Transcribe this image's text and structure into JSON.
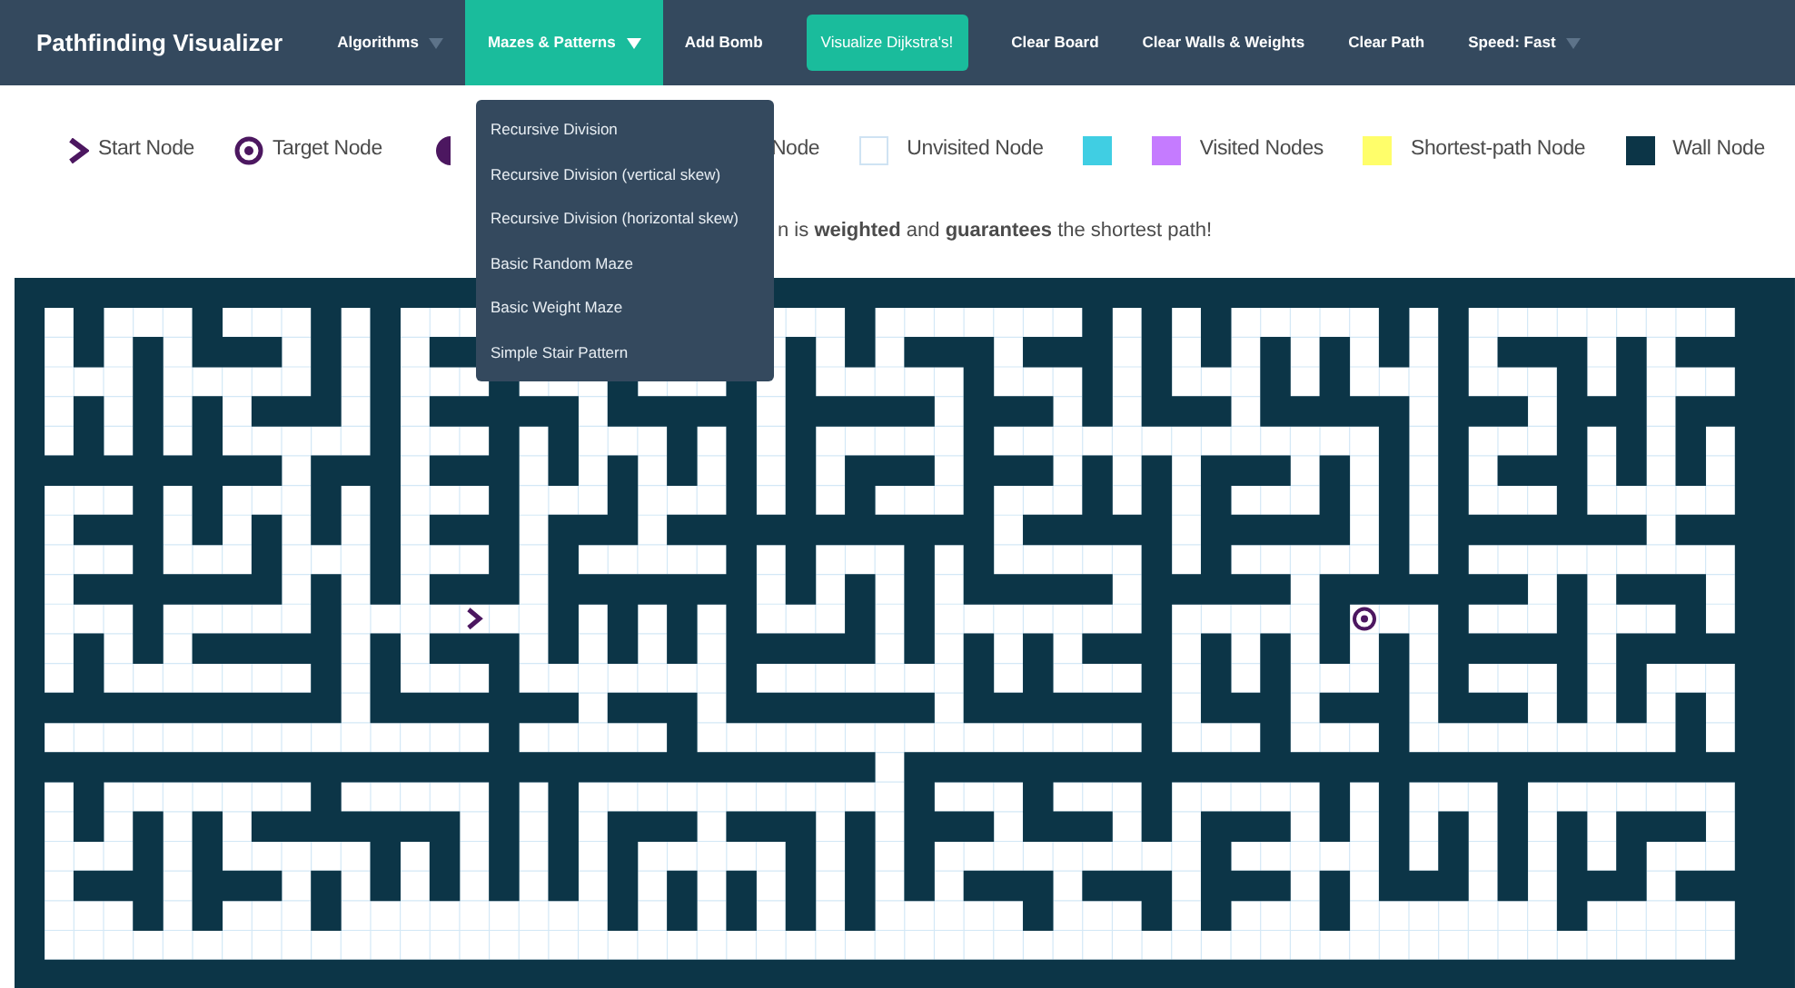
{
  "navbar": {
    "brand": "Pathfinding Visualizer",
    "items": [
      {
        "label": "Algorithms",
        "kind": "dropdown",
        "selected": false
      },
      {
        "label": "Mazes & Patterns",
        "kind": "dropdown",
        "selected": true
      },
      {
        "label": "Add Bomb",
        "kind": "link",
        "selected": false
      },
      {
        "label": "Visualize Dijkstra's!",
        "kind": "button",
        "selected": false
      },
      {
        "label": "Clear Board",
        "kind": "link",
        "selected": false
      },
      {
        "label": "Clear Walls & Weights",
        "kind": "link",
        "selected": false
      },
      {
        "label": "Clear Path",
        "kind": "link",
        "selected": false
      },
      {
        "label": "Speed: Fast",
        "kind": "dropdown",
        "selected": false
      }
    ]
  },
  "dropdown_menu": {
    "items": [
      "Recursive Division",
      "Recursive Division (vertical skew)",
      "Recursive Division (horizontal skew)",
      "Basic Random Maze",
      "Basic Weight Maze",
      "Simple Stair Pattern"
    ]
  },
  "legend": [
    {
      "kind": "start",
      "label": "Start Node"
    },
    {
      "kind": "target",
      "label": "Target Node"
    },
    {
      "kind": "bomb"
    },
    {
      "kind": "text",
      "label": "Node"
    },
    {
      "kind": "unvisited",
      "label": "Unvisited Node"
    },
    {
      "kind": "visited",
      "label": "Visited Nodes"
    },
    {
      "kind": "shortest",
      "label": "Shortest-path Node"
    },
    {
      "kind": "wall",
      "label": "Wall Node"
    }
  ],
  "description": "n is **weighted** and **guarantees** the shortest path!",
  "grid": {
    "kind": "maze"
  }
}
